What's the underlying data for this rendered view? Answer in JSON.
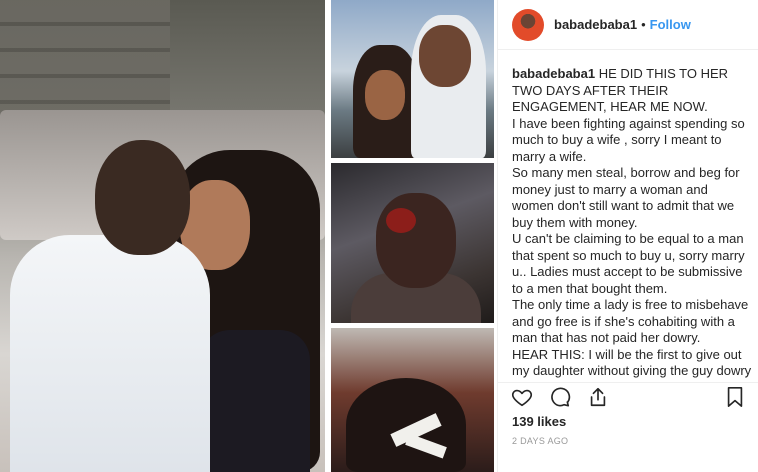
{
  "colors": {
    "link": "#3897f0",
    "text": "#262626",
    "muted": "#999999",
    "border": "#efefef"
  },
  "post": {
    "images": [
      {
        "name": "photo-couple-kissing"
      },
      {
        "name": "photo-couple-selfie"
      },
      {
        "name": "photo-injured-woman"
      },
      {
        "name": "photo-bandaged-head"
      }
    ]
  },
  "header": {
    "username": "babadebaba1",
    "separator": "•",
    "follow_label": "Follow",
    "avatar_icon": "avatar-icon"
  },
  "caption": {
    "username": "babadebaba1",
    "lines": [
      "HE DID THIS TO HER TWO DAYS AFTER THEIR ENGAGEMENT, HEAR ME NOW.",
      "I have been fighting against spending so much to buy a wife , sorry I meant to marry a wife.",
      "So many men steal, borrow and beg for money just to marry a woman and women don't still want to admit that we buy them with money.",
      "U can't be claiming to be equal to a man that spent so much to buy u, sorry marry u.. Ladies must accept to be submissive to a men that bought them.",
      "The only time a lady is free to misbehave and go free is if she's cohabiting with a man that has not paid her dowry.",
      "HEAR THIS: I will be the first to give out my daughter without giving the guy dowry list so that he will know that they are equal and"
    ]
  },
  "actions": {
    "like_icon": "heart-icon",
    "comment_icon": "comment-icon",
    "share_icon": "share-icon",
    "save_icon": "bookmark-icon"
  },
  "likes_text": "139 likes",
  "timestamp": "2 DAYS AGO"
}
